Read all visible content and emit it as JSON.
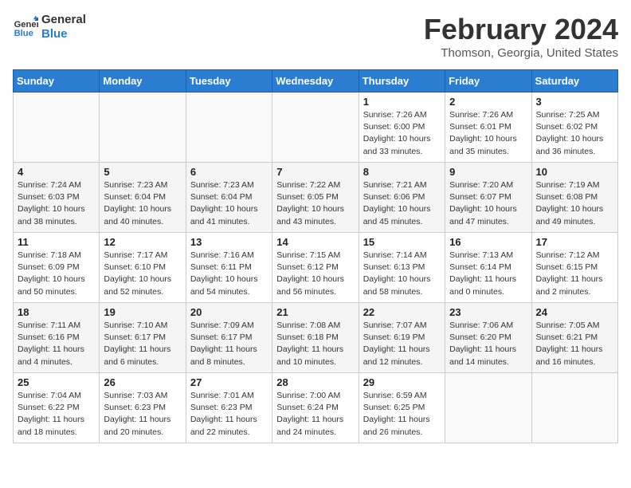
{
  "logo": {
    "line1": "General",
    "line2": "Blue"
  },
  "title": "February 2024",
  "subtitle": "Thomson, Georgia, United States",
  "headers": [
    "Sunday",
    "Monday",
    "Tuesday",
    "Wednesday",
    "Thursday",
    "Friday",
    "Saturday"
  ],
  "weeks": [
    [
      {
        "day": "",
        "content": ""
      },
      {
        "day": "",
        "content": ""
      },
      {
        "day": "",
        "content": ""
      },
      {
        "day": "",
        "content": ""
      },
      {
        "day": "1",
        "content": "Sunrise: 7:26 AM\nSunset: 6:00 PM\nDaylight: 10 hours\nand 33 minutes."
      },
      {
        "day": "2",
        "content": "Sunrise: 7:26 AM\nSunset: 6:01 PM\nDaylight: 10 hours\nand 35 minutes."
      },
      {
        "day": "3",
        "content": "Sunrise: 7:25 AM\nSunset: 6:02 PM\nDaylight: 10 hours\nand 36 minutes."
      }
    ],
    [
      {
        "day": "4",
        "content": "Sunrise: 7:24 AM\nSunset: 6:03 PM\nDaylight: 10 hours\nand 38 minutes."
      },
      {
        "day": "5",
        "content": "Sunrise: 7:23 AM\nSunset: 6:04 PM\nDaylight: 10 hours\nand 40 minutes."
      },
      {
        "day": "6",
        "content": "Sunrise: 7:23 AM\nSunset: 6:04 PM\nDaylight: 10 hours\nand 41 minutes."
      },
      {
        "day": "7",
        "content": "Sunrise: 7:22 AM\nSunset: 6:05 PM\nDaylight: 10 hours\nand 43 minutes."
      },
      {
        "day": "8",
        "content": "Sunrise: 7:21 AM\nSunset: 6:06 PM\nDaylight: 10 hours\nand 45 minutes."
      },
      {
        "day": "9",
        "content": "Sunrise: 7:20 AM\nSunset: 6:07 PM\nDaylight: 10 hours\nand 47 minutes."
      },
      {
        "day": "10",
        "content": "Sunrise: 7:19 AM\nSunset: 6:08 PM\nDaylight: 10 hours\nand 49 minutes."
      }
    ],
    [
      {
        "day": "11",
        "content": "Sunrise: 7:18 AM\nSunset: 6:09 PM\nDaylight: 10 hours\nand 50 minutes."
      },
      {
        "day": "12",
        "content": "Sunrise: 7:17 AM\nSunset: 6:10 PM\nDaylight: 10 hours\nand 52 minutes."
      },
      {
        "day": "13",
        "content": "Sunrise: 7:16 AM\nSunset: 6:11 PM\nDaylight: 10 hours\nand 54 minutes."
      },
      {
        "day": "14",
        "content": "Sunrise: 7:15 AM\nSunset: 6:12 PM\nDaylight: 10 hours\nand 56 minutes."
      },
      {
        "day": "15",
        "content": "Sunrise: 7:14 AM\nSunset: 6:13 PM\nDaylight: 10 hours\nand 58 minutes."
      },
      {
        "day": "16",
        "content": "Sunrise: 7:13 AM\nSunset: 6:14 PM\nDaylight: 11 hours\nand 0 minutes."
      },
      {
        "day": "17",
        "content": "Sunrise: 7:12 AM\nSunset: 6:15 PM\nDaylight: 11 hours\nand 2 minutes."
      }
    ],
    [
      {
        "day": "18",
        "content": "Sunrise: 7:11 AM\nSunset: 6:16 PM\nDaylight: 11 hours\nand 4 minutes."
      },
      {
        "day": "19",
        "content": "Sunrise: 7:10 AM\nSunset: 6:17 PM\nDaylight: 11 hours\nand 6 minutes."
      },
      {
        "day": "20",
        "content": "Sunrise: 7:09 AM\nSunset: 6:17 PM\nDaylight: 11 hours\nand 8 minutes."
      },
      {
        "day": "21",
        "content": "Sunrise: 7:08 AM\nSunset: 6:18 PM\nDaylight: 11 hours\nand 10 minutes."
      },
      {
        "day": "22",
        "content": "Sunrise: 7:07 AM\nSunset: 6:19 PM\nDaylight: 11 hours\nand 12 minutes."
      },
      {
        "day": "23",
        "content": "Sunrise: 7:06 AM\nSunset: 6:20 PM\nDaylight: 11 hours\nand 14 minutes."
      },
      {
        "day": "24",
        "content": "Sunrise: 7:05 AM\nSunset: 6:21 PM\nDaylight: 11 hours\nand 16 minutes."
      }
    ],
    [
      {
        "day": "25",
        "content": "Sunrise: 7:04 AM\nSunset: 6:22 PM\nDaylight: 11 hours\nand 18 minutes."
      },
      {
        "day": "26",
        "content": "Sunrise: 7:03 AM\nSunset: 6:23 PM\nDaylight: 11 hours\nand 20 minutes."
      },
      {
        "day": "27",
        "content": "Sunrise: 7:01 AM\nSunset: 6:23 PM\nDaylight: 11 hours\nand 22 minutes."
      },
      {
        "day": "28",
        "content": "Sunrise: 7:00 AM\nSunset: 6:24 PM\nDaylight: 11 hours\nand 24 minutes."
      },
      {
        "day": "29",
        "content": "Sunrise: 6:59 AM\nSunset: 6:25 PM\nDaylight: 11 hours\nand 26 minutes."
      },
      {
        "day": "",
        "content": ""
      },
      {
        "day": "",
        "content": ""
      }
    ]
  ]
}
